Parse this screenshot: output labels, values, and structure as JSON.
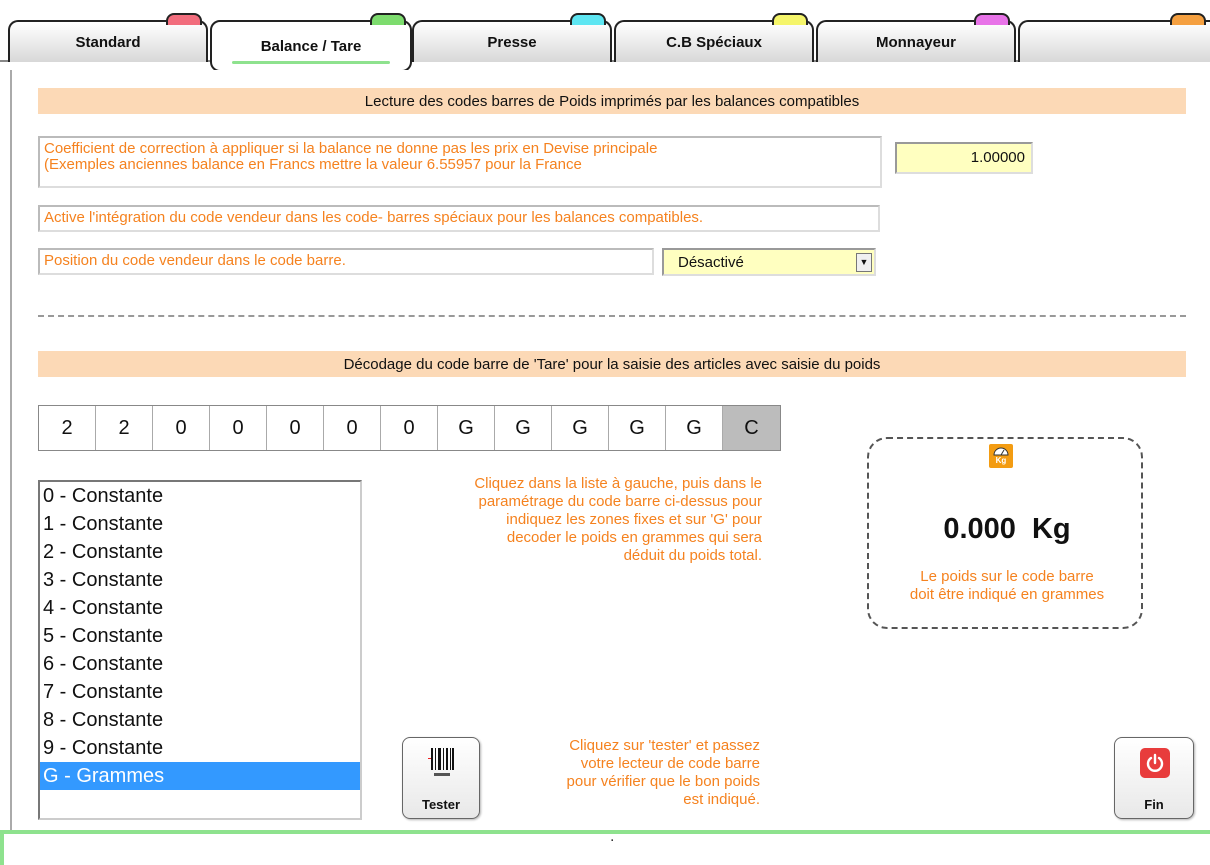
{
  "tabs": [
    {
      "label": "Standard",
      "color": "#f26d7d"
    },
    {
      "label": "Balance / Tare",
      "color": "#7ddc6e"
    },
    {
      "label": "Presse",
      "color": "#5ee6f2"
    },
    {
      "label": "C.B Spéciaux",
      "color": "#f5f56a"
    },
    {
      "label": "Monnayeur",
      "color": "#e873e8"
    },
    {
      "label": "",
      "color": "#f5a040"
    }
  ],
  "section1": {
    "title": "Lecture des codes barres de Poids imprimés par les balances compatibles",
    "coef_line1": "Coefficient de correction à appliquer si la balance ne donne pas les prix en Devise principale",
    "coef_line2": "(Exemples anciennes balance en Francs mettre la valeur 6.55957 pour la France",
    "coef_value": "1.00000",
    "vendor_integration": "Active l'intégration du code vendeur dans les code- barres spéciaux pour les balances compatibles.",
    "vendor_position": "Position du code vendeur dans le code barre.",
    "vendor_select": "Désactivé"
  },
  "section2": {
    "title": "Décodage du code barre de 'Tare' pour la saisie des articles avec saisie du poids",
    "barcode": [
      "2",
      "2",
      "0",
      "0",
      "0",
      "0",
      "0",
      "G",
      "G",
      "G",
      "G",
      "G",
      "C"
    ],
    "list": [
      "0 - Constante",
      "1 - Constante",
      "2 - Constante",
      "3 - Constante",
      "4 - Constante",
      "5 - Constante",
      "6 - Constante",
      "7 - Constante",
      "8 - Constante",
      "9 - Constante",
      "G - Grammes"
    ],
    "selected_index": 10,
    "help_text": [
      "Cliquez dans la liste à gauche, puis dans le",
      "paramétrage du code barre ci-dessus pour",
      "indiquez les zones fixes et  sur 'G' pour",
      "decoder le poids en grammes qui sera",
      "déduit du poids total."
    ],
    "test_text": [
      "Cliquez sur 'tester' et passez",
      "votre lecteur de code barre",
      "pour vérifier que le bon poids",
      "est indiqué."
    ],
    "weight_value": "0.000",
    "weight_unit": "Kg",
    "weight_icon_label": "Kg",
    "weight_note_line1": "Le poids sur le code barre",
    "weight_note_line2": "doit être indiqué en grammes",
    "test_button": "Tester",
    "end_button": "Fin"
  },
  "bottom": {
    "text": "."
  }
}
